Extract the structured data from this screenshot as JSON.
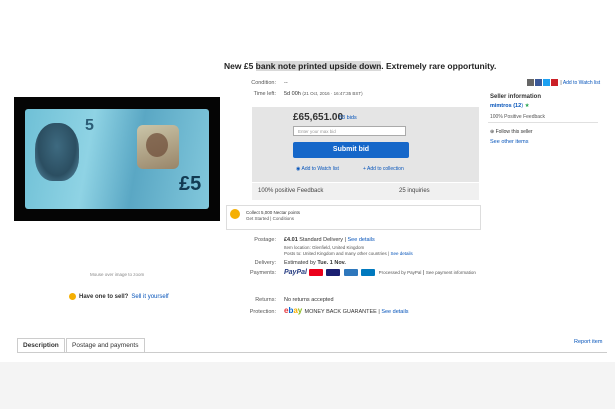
{
  "listing": {
    "title_pre": "New £5 ",
    "title_highlight": "bank note printed upside down",
    "title_post": ". Extremely rare opportunity."
  },
  "image": {
    "hint": "Mouse over image to zoom"
  },
  "sell_prompt": {
    "question": "Have one to sell?",
    "link": "Sell it yourself"
  },
  "details": {
    "condition_label": "Condition:",
    "condition_value": "--",
    "time_left_label": "Time left:",
    "time_left_value": "5d 00h",
    "time_left_detail": "(21 Oct, 2016 · 16:47:35 BST)",
    "price": "£65,651.00",
    "bids": "53 bids",
    "bid_placeholder": "Enter your max bid",
    "submit_label": "Submit bid",
    "watch_label": "Add to Watch list",
    "collection_label": "Add to collection",
    "positive_feedback": "100% positive Feedback",
    "inquiries": "25 inquiries",
    "points_line1": "Collect 5,000 Nectar points",
    "points_line2": "Get Started | Conditions",
    "postage_label": "Postage:",
    "postage_value": "£4.01",
    "postage_method": "Standard Delivery",
    "see_details": "See details",
    "item_location": "Item location: Glenfield, United Kingdom",
    "posts_to": "Posts to: United Kingdom and many other countries",
    "delivery_label": "Delivery:",
    "delivery_value": "Estimated by",
    "delivery_date": "Tue. 1 Nov.",
    "payments_label": "Payments:",
    "paypal": "PayPal",
    "processed_by": "Processed by PayPal",
    "see_payment": "See payment information",
    "returns_label": "Returns:",
    "returns_value": "No returns accepted",
    "protection_label": "Protection:",
    "mbg": "MONEY BACK GUARANTEE",
    "ebay": "ebay"
  },
  "seller": {
    "heading": "Seller information",
    "name": "mimtros (12",
    "name_suffix": ")",
    "feedback": "100% Positive Feedback",
    "follow": "Follow this seller",
    "other_items": "See other items"
  },
  "share": {
    "watch_list": "Add to Watch list"
  },
  "tabs": {
    "description": "Description",
    "postage": "Postage and payments",
    "report": "Report item"
  },
  "colors": {
    "link": "#0654ba",
    "submit": "#1667c9",
    "bidbox": "#e5e5e5"
  }
}
